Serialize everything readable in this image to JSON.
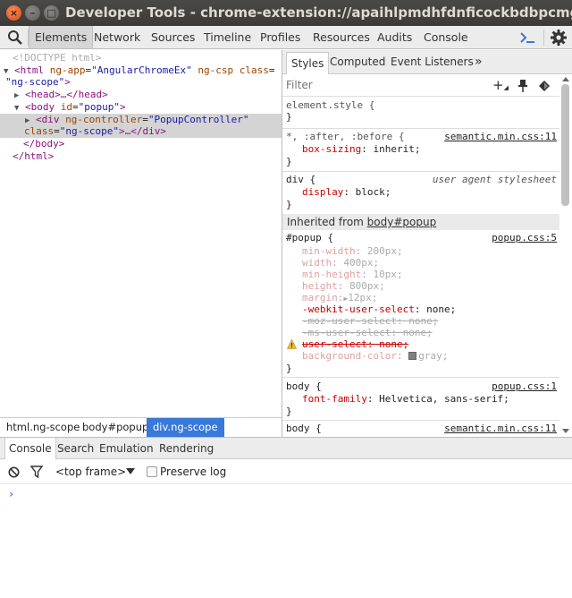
{
  "window": {
    "title": "Developer Tools - chrome-extension://apaihlpmdhfdnficockbdbpcmgakjgnk/ap",
    "close_glyph": "×",
    "min_glyph": "–",
    "max_glyph": "□"
  },
  "toolbar": {
    "tabs": [
      "Elements",
      "Network",
      "Sources",
      "Timeline",
      "Profiles",
      "Resources",
      "Audits",
      "Console"
    ],
    "selected": "Elements"
  },
  "elements_tree": {
    "doctype": "<!DOCTYPE html>",
    "html_open_1": "<html",
    "html_attr1_name": " ng-app",
    "html_attr1_val": "\"AngularChromeEx\"",
    "html_attr2_name": " ng-csp class",
    "html_line2_val": "\"ng-scope\"",
    "head_line": "<head>…</head>",
    "body_open": "<body",
    "body_attr_name": " id",
    "body_attr_val": "\"popup\"",
    "div_open": "<div",
    "div_attr_name": " ng-controller",
    "div_attr_val": "\"PopupController\"",
    "div_class_name": "class",
    "div_class_val": "\"ng-scope\"",
    "div_close": ">…</div>",
    "body_close": "</body>",
    "html_close": "</html>"
  },
  "breadcrumbs": [
    "html.ng-scope",
    "body#popup",
    "div.ng-scope"
  ],
  "side_tabs": {
    "styles": "Styles",
    "computed": "Computed",
    "listeners": "Event Listeners",
    "more": "»"
  },
  "filter": {
    "placeholder": "Filter",
    "plus": "+"
  },
  "styles": {
    "element_style": {
      "selector": "element.style {",
      "close": "}"
    },
    "universal": {
      "selector": "*, :after, :before {",
      "source": "semantic.min.css:11",
      "prop": "box-sizing",
      "value": "inherit;"
    },
    "div_rule": {
      "selector": "div {",
      "source": "user agent stylesheet",
      "prop": "display",
      "value": "block;"
    },
    "inherited_label": "Inherited from ",
    "inherited_from": "body#popup",
    "popup_rule": {
      "selector": "#popup {",
      "source": "popup.css:5",
      "props": [
        {
          "name": "min-width",
          "value": "200px;"
        },
        {
          "name": "width",
          "value": "400px;"
        },
        {
          "name": "min-height",
          "value": "10px;"
        },
        {
          "name": "height",
          "value": "800px;"
        },
        {
          "name": "margin",
          "value": "12px;"
        },
        {
          "name": "-webkit-user-select",
          "value": "none;"
        },
        {
          "name": "-moz-user-select",
          "value": "none;"
        },
        {
          "name": "-ms-user-select",
          "value": "none;"
        },
        {
          "name": "user-select",
          "value": "none;"
        },
        {
          "name": "background-color",
          "value": "gray;"
        }
      ]
    },
    "body_rule1": {
      "selector": "body {",
      "source": "popup.css:1",
      "prop": "font-family",
      "value": "Helvetica, sans-serif;"
    },
    "body_rule2": {
      "selector": "body {",
      "source": "semantic.min.css:11"
    },
    "close_brace": "}"
  },
  "drawer": {
    "tabs": [
      "Console",
      "Search",
      "Emulation",
      "Rendering"
    ],
    "selected": "Console",
    "frame_select": "<top frame>",
    "preserve_log": "Preserve log",
    "prompt": "›"
  },
  "colors": {
    "titlebar": "#3c3b37",
    "accent_selection": "#3879d9",
    "css_property": "#c80000",
    "html_tag": "#881280"
  }
}
